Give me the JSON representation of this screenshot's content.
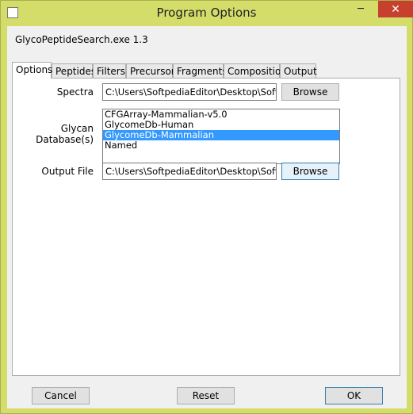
{
  "window": {
    "title": "Program Options",
    "minimize_glyph": "─",
    "maximize_glyph": "☐",
    "close_glyph": "✕"
  },
  "app_version": "GlycoPeptideSearch.exe 1.3",
  "tabs": [
    {
      "label": "Options",
      "active": true
    },
    {
      "label": "Peptides"
    },
    {
      "label": "Filters"
    },
    {
      "label": "Precursor"
    },
    {
      "label": "Fragments"
    },
    {
      "label": "Composition"
    },
    {
      "label": "Output"
    }
  ],
  "options": {
    "spectra_label": "Spectra",
    "spectra_value": "C:\\Users\\SoftpediaEditor\\Desktop\\Softpedia",
    "spectra_browse": "Browse",
    "glycan_label": "Glycan Database(s)",
    "glycan_items": [
      "CFGArray-Mammalian-v5.0",
      "GlycomeDb-Human",
      "GlycomeDb-Mammalian",
      "Named"
    ],
    "glycan_selected_index": 2,
    "output_label": "Output File",
    "output_value": "C:\\Users\\SoftpediaEditor\\Desktop\\Softpedia",
    "output_browse": "Browse"
  },
  "buttons": {
    "cancel": "Cancel",
    "reset": "Reset",
    "ok": "OK"
  }
}
